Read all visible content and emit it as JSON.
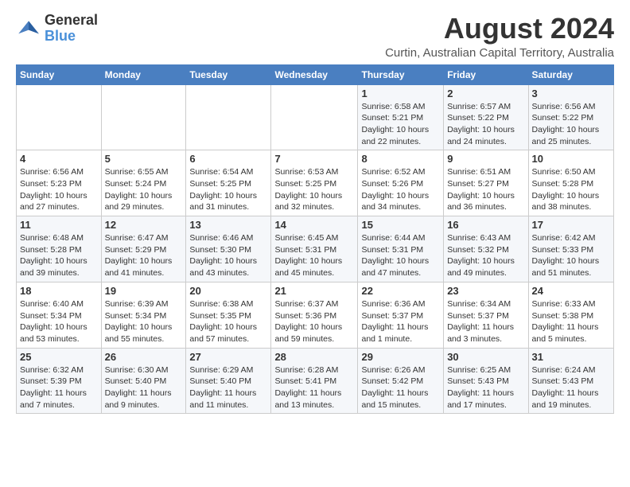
{
  "logo": {
    "line1": "General",
    "line2": "Blue"
  },
  "title": "August 2024",
  "location": "Curtin, Australian Capital Territory, Australia",
  "days_header": [
    "Sunday",
    "Monday",
    "Tuesday",
    "Wednesday",
    "Thursday",
    "Friday",
    "Saturday"
  ],
  "weeks": [
    [
      {
        "day": "",
        "info": ""
      },
      {
        "day": "",
        "info": ""
      },
      {
        "day": "",
        "info": ""
      },
      {
        "day": "",
        "info": ""
      },
      {
        "day": "1",
        "info": "Sunrise: 6:58 AM\nSunset: 5:21 PM\nDaylight: 10 hours\nand 22 minutes."
      },
      {
        "day": "2",
        "info": "Sunrise: 6:57 AM\nSunset: 5:22 PM\nDaylight: 10 hours\nand 24 minutes."
      },
      {
        "day": "3",
        "info": "Sunrise: 6:56 AM\nSunset: 5:22 PM\nDaylight: 10 hours\nand 25 minutes."
      }
    ],
    [
      {
        "day": "4",
        "info": "Sunrise: 6:56 AM\nSunset: 5:23 PM\nDaylight: 10 hours\nand 27 minutes."
      },
      {
        "day": "5",
        "info": "Sunrise: 6:55 AM\nSunset: 5:24 PM\nDaylight: 10 hours\nand 29 minutes."
      },
      {
        "day": "6",
        "info": "Sunrise: 6:54 AM\nSunset: 5:25 PM\nDaylight: 10 hours\nand 31 minutes."
      },
      {
        "day": "7",
        "info": "Sunrise: 6:53 AM\nSunset: 5:25 PM\nDaylight: 10 hours\nand 32 minutes."
      },
      {
        "day": "8",
        "info": "Sunrise: 6:52 AM\nSunset: 5:26 PM\nDaylight: 10 hours\nand 34 minutes."
      },
      {
        "day": "9",
        "info": "Sunrise: 6:51 AM\nSunset: 5:27 PM\nDaylight: 10 hours\nand 36 minutes."
      },
      {
        "day": "10",
        "info": "Sunrise: 6:50 AM\nSunset: 5:28 PM\nDaylight: 10 hours\nand 38 minutes."
      }
    ],
    [
      {
        "day": "11",
        "info": "Sunrise: 6:48 AM\nSunset: 5:28 PM\nDaylight: 10 hours\nand 39 minutes."
      },
      {
        "day": "12",
        "info": "Sunrise: 6:47 AM\nSunset: 5:29 PM\nDaylight: 10 hours\nand 41 minutes."
      },
      {
        "day": "13",
        "info": "Sunrise: 6:46 AM\nSunset: 5:30 PM\nDaylight: 10 hours\nand 43 minutes."
      },
      {
        "day": "14",
        "info": "Sunrise: 6:45 AM\nSunset: 5:31 PM\nDaylight: 10 hours\nand 45 minutes."
      },
      {
        "day": "15",
        "info": "Sunrise: 6:44 AM\nSunset: 5:31 PM\nDaylight: 10 hours\nand 47 minutes."
      },
      {
        "day": "16",
        "info": "Sunrise: 6:43 AM\nSunset: 5:32 PM\nDaylight: 10 hours\nand 49 minutes."
      },
      {
        "day": "17",
        "info": "Sunrise: 6:42 AM\nSunset: 5:33 PM\nDaylight: 10 hours\nand 51 minutes."
      }
    ],
    [
      {
        "day": "18",
        "info": "Sunrise: 6:40 AM\nSunset: 5:34 PM\nDaylight: 10 hours\nand 53 minutes."
      },
      {
        "day": "19",
        "info": "Sunrise: 6:39 AM\nSunset: 5:34 PM\nDaylight: 10 hours\nand 55 minutes."
      },
      {
        "day": "20",
        "info": "Sunrise: 6:38 AM\nSunset: 5:35 PM\nDaylight: 10 hours\nand 57 minutes."
      },
      {
        "day": "21",
        "info": "Sunrise: 6:37 AM\nSunset: 5:36 PM\nDaylight: 10 hours\nand 59 minutes."
      },
      {
        "day": "22",
        "info": "Sunrise: 6:36 AM\nSunset: 5:37 PM\nDaylight: 11 hours\nand 1 minute."
      },
      {
        "day": "23",
        "info": "Sunrise: 6:34 AM\nSunset: 5:37 PM\nDaylight: 11 hours\nand 3 minutes."
      },
      {
        "day": "24",
        "info": "Sunrise: 6:33 AM\nSunset: 5:38 PM\nDaylight: 11 hours\nand 5 minutes."
      }
    ],
    [
      {
        "day": "25",
        "info": "Sunrise: 6:32 AM\nSunset: 5:39 PM\nDaylight: 11 hours\nand 7 minutes."
      },
      {
        "day": "26",
        "info": "Sunrise: 6:30 AM\nSunset: 5:40 PM\nDaylight: 11 hours\nand 9 minutes."
      },
      {
        "day": "27",
        "info": "Sunrise: 6:29 AM\nSunset: 5:40 PM\nDaylight: 11 hours\nand 11 minutes."
      },
      {
        "day": "28",
        "info": "Sunrise: 6:28 AM\nSunset: 5:41 PM\nDaylight: 11 hours\nand 13 minutes."
      },
      {
        "day": "29",
        "info": "Sunrise: 6:26 AM\nSunset: 5:42 PM\nDaylight: 11 hours\nand 15 minutes."
      },
      {
        "day": "30",
        "info": "Sunrise: 6:25 AM\nSunset: 5:43 PM\nDaylight: 11 hours\nand 17 minutes."
      },
      {
        "day": "31",
        "info": "Sunrise: 6:24 AM\nSunset: 5:43 PM\nDaylight: 11 hours\nand 19 minutes."
      }
    ]
  ]
}
